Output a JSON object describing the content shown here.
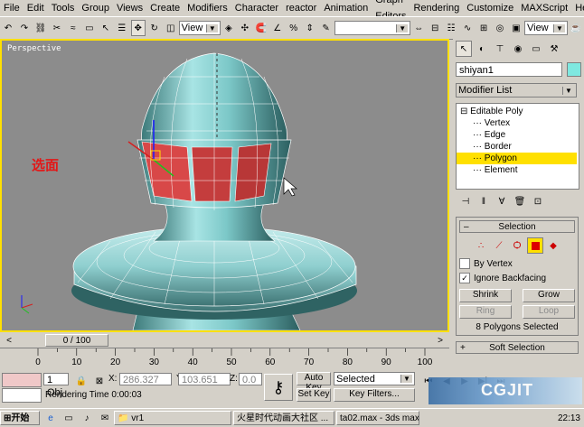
{
  "menu": [
    "File",
    "Edit",
    "Tools",
    "Group",
    "Views",
    "Create",
    "Modifiers",
    "Character",
    "reactor",
    "Animation",
    "Graph Editors",
    "Rendering",
    "Customize",
    "MAXScript",
    "Help"
  ],
  "toolbar": {
    "refcoord_value": "View",
    "refcoord_value_right": "View",
    "named_sel": ""
  },
  "viewport": {
    "label": "Perspective",
    "annotation": "选面"
  },
  "panel": {
    "object_name": "shiyan1",
    "object_color": "#7fe8e0",
    "modifier_list": "Modifier List",
    "stack": [
      "Editable Poly",
      "Vertex",
      "Edge",
      "Border",
      "Polygon",
      "Element"
    ],
    "selected_index": 4,
    "selection_title": "Selection",
    "by_vertex": "By Vertex",
    "ignore_backfacing": "Ignore Backfacing",
    "shrink": "Shrink",
    "grow": "Grow",
    "ring": "Ring",
    "loop": "Loop",
    "sel_count": "8 Polygons Selected",
    "soft_selection": "Soft Selection"
  },
  "timeline": {
    "frame": "0 / 100",
    "ticks": [
      "0",
      "10",
      "20",
      "30",
      "40",
      "50",
      "60",
      "70",
      "80",
      "90",
      "100"
    ]
  },
  "status": {
    "objects": "1 Obj",
    "x": "286.327",
    "y": "103.651",
    "z": "0.0",
    "render_time": "Rendering Time 0:00:03",
    "auto_key": "Auto Key",
    "set_key": "Set Key",
    "selected": "Selected",
    "key_filters": "Key Filters..."
  },
  "taskbar": {
    "start": "开始",
    "items": [
      "vr1",
      "火星时代动画大社区 ...",
      "ta02.max - 3ds max 6 -"
    ],
    "clock": "22:13"
  },
  "watermark": "CGJIT"
}
